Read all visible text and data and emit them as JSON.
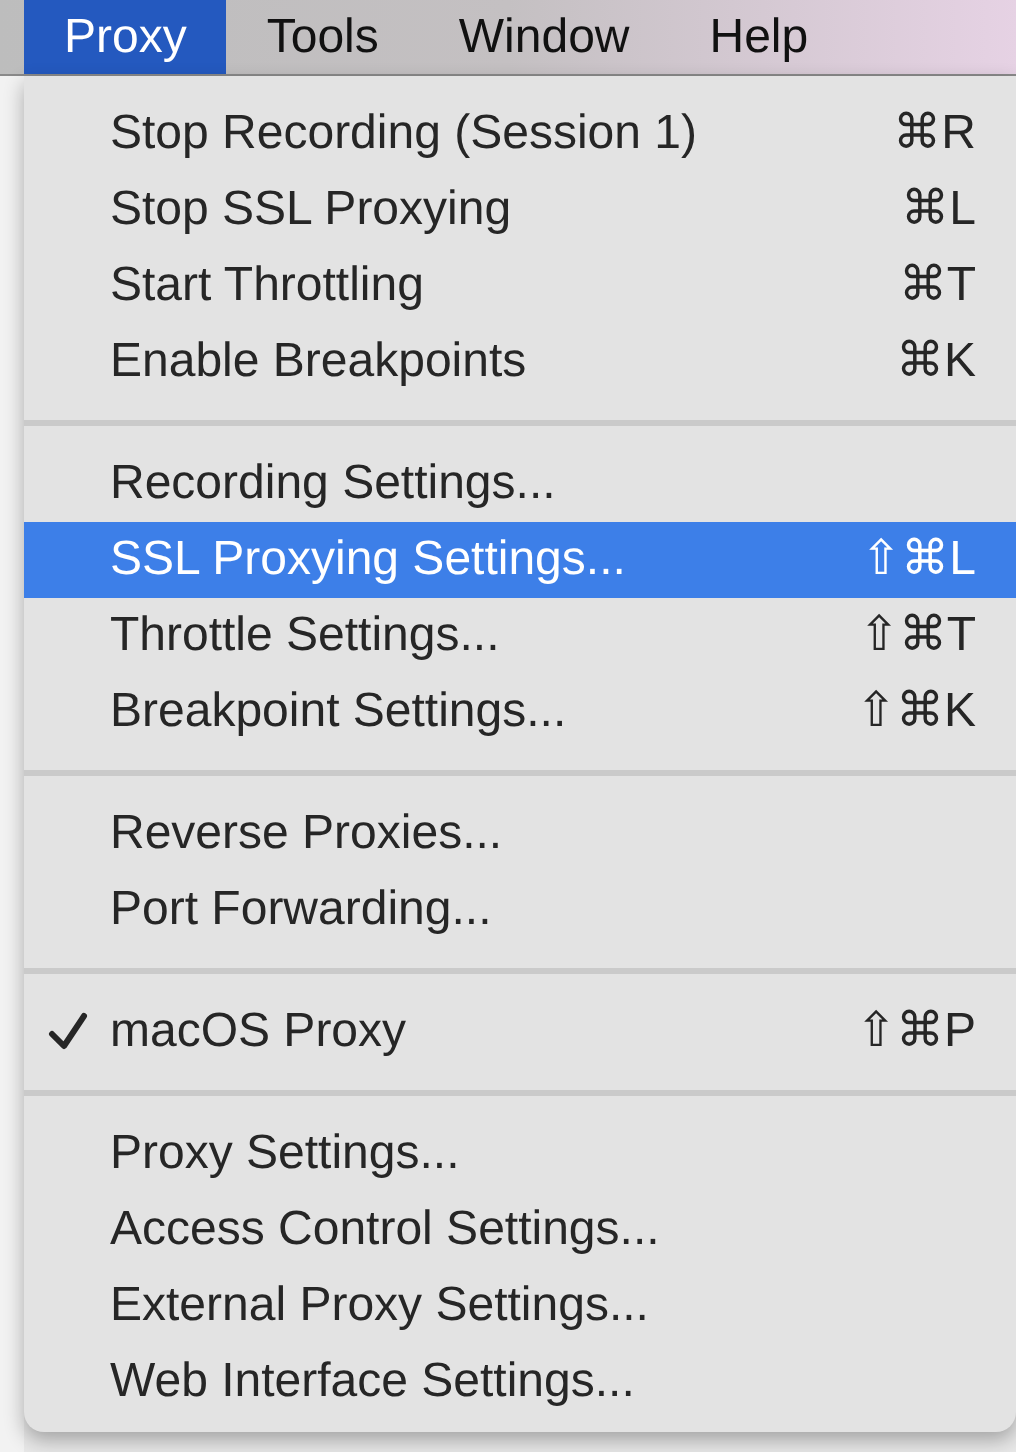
{
  "menu_bar": [
    {
      "label": "Proxy",
      "selected": true
    },
    {
      "label": "Tools",
      "selected": false
    },
    {
      "label": "Window",
      "selected": false
    },
    {
      "label": "Help",
      "selected": false
    }
  ],
  "menu": {
    "groups": [
      [
        {
          "label": "Stop Recording (Session 1)",
          "shortcut": "⌘R",
          "selected": false,
          "checked": false
        },
        {
          "label": "Stop SSL Proxying",
          "shortcut": "⌘L",
          "selected": false,
          "checked": false
        },
        {
          "label": "Start Throttling",
          "shortcut": "⌘T",
          "selected": false,
          "checked": false
        },
        {
          "label": "Enable Breakpoints",
          "shortcut": "⌘K",
          "selected": false,
          "checked": false
        }
      ],
      [
        {
          "label": "Recording Settings...",
          "selected": false,
          "checked": false
        },
        {
          "label": "SSL Proxying Settings...",
          "shortcut": "⇧⌘L",
          "selected": true,
          "checked": false
        },
        {
          "label": "Throttle Settings...",
          "shortcut": "⇧⌘T",
          "selected": false,
          "checked": false
        },
        {
          "label": "Breakpoint Settings...",
          "shortcut": "⇧⌘K",
          "selected": false,
          "checked": false
        }
      ],
      [
        {
          "label": "Reverse Proxies...",
          "selected": false,
          "checked": false
        },
        {
          "label": "Port Forwarding...",
          "selected": false,
          "checked": false
        }
      ],
      [
        {
          "label": "macOS Proxy",
          "shortcut": "⇧⌘P",
          "selected": false,
          "checked": true
        }
      ],
      [
        {
          "label": "Proxy Settings...",
          "selected": false,
          "checked": false
        },
        {
          "label": "Access Control Settings...",
          "selected": false,
          "checked": false
        },
        {
          "label": "External Proxy Settings...",
          "selected": false,
          "checked": false
        },
        {
          "label": "Web Interface Settings...",
          "selected": false,
          "checked": false
        }
      ]
    ]
  }
}
